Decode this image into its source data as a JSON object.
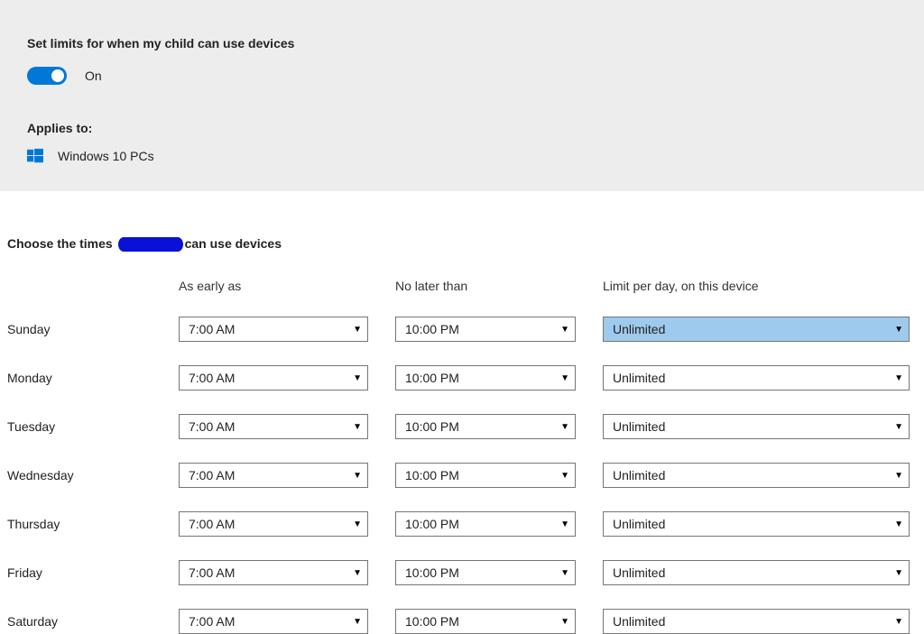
{
  "header": {
    "set_limits_title": "Set limits for when my child can use devices",
    "toggle_state": "On",
    "applies_to_title": "Applies to:",
    "applies_to_device": "Windows 10 PCs"
  },
  "choose_times": {
    "prefix": "Choose the times",
    "redacted_name": "",
    "suffix": "can use devices"
  },
  "columns": {
    "early": "As early as",
    "late": "No later than",
    "limit": "Limit per day, on this device"
  },
  "days": [
    {
      "name": "Sunday",
      "early": "7:00 AM",
      "late": "10:00 PM",
      "limit": "Unlimited",
      "highlight": true
    },
    {
      "name": "Monday",
      "early": "7:00 AM",
      "late": "10:00 PM",
      "limit": "Unlimited",
      "highlight": false
    },
    {
      "name": "Tuesday",
      "early": "7:00 AM",
      "late": "10:00 PM",
      "limit": "Unlimited",
      "highlight": false
    },
    {
      "name": "Wednesday",
      "early": "7:00 AM",
      "late": "10:00 PM",
      "limit": "Unlimited",
      "highlight": false
    },
    {
      "name": "Thursday",
      "early": "7:00 AM",
      "late": "10:00 PM",
      "limit": "Unlimited",
      "highlight": false
    },
    {
      "name": "Friday",
      "early": "7:00 AM",
      "late": "10:00 PM",
      "limit": "Unlimited",
      "highlight": false
    },
    {
      "name": "Saturday",
      "early": "7:00 AM",
      "late": "10:00 PM",
      "limit": "Unlimited",
      "highlight": false
    }
  ]
}
